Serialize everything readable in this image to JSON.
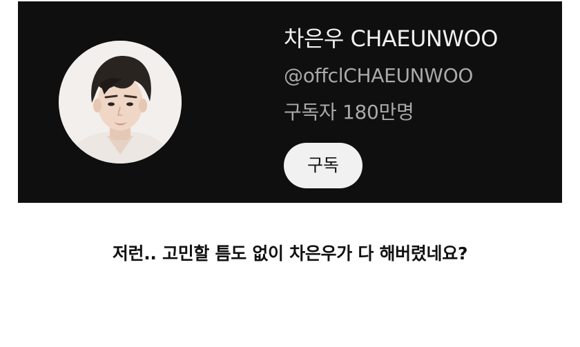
{
  "channel": {
    "name": "차은우 CHAEUNWOO",
    "handle": "@offclCHAEUNWOO",
    "subscribers": "구독자 180만명",
    "subscribe_label": "구독"
  },
  "caption": {
    "text": "저런.. 고민할 틈도 없이 차은우가 다 해버렸네요?"
  },
  "colors": {
    "card_background": "#0f0f0f",
    "primary_text": "#f1f1f1",
    "secondary_text": "#aaaaaa",
    "button_background": "#f1f1f1",
    "caption_text": "#111111"
  },
  "icons": {
    "avatar": "channel-avatar-portrait"
  }
}
